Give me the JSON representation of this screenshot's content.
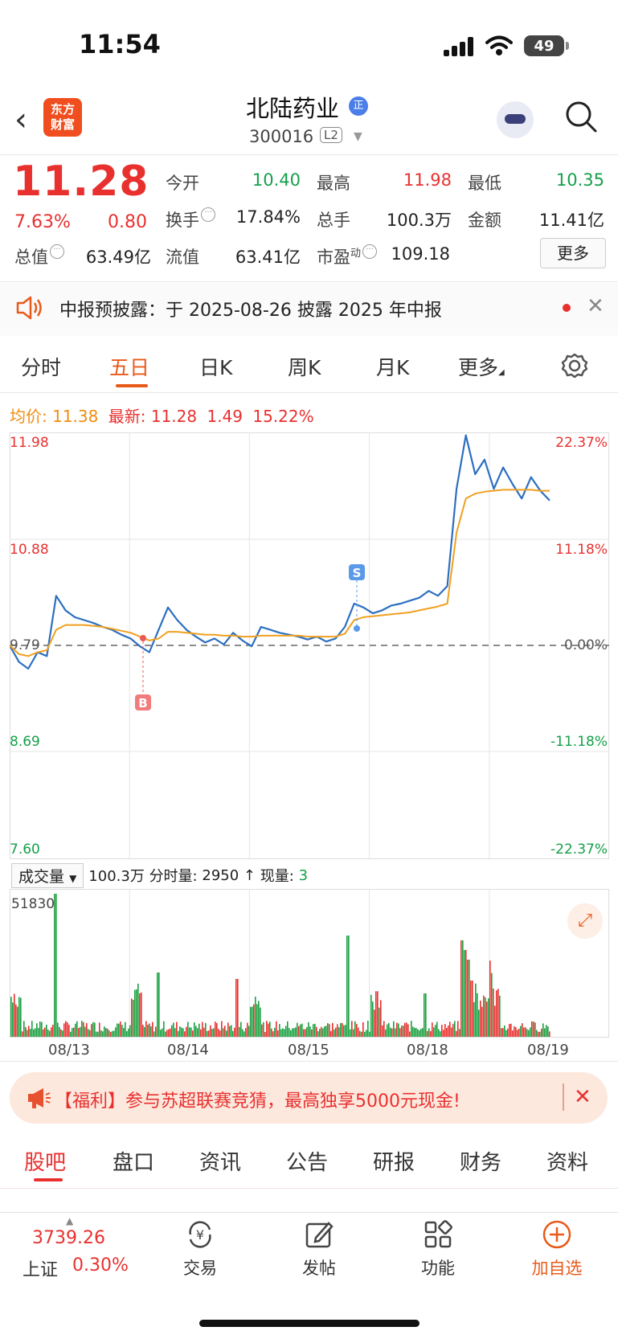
{
  "status_bar": {
    "time": "11:54",
    "battery": "49"
  },
  "header": {
    "logo_line1": "东方",
    "logo_line2": "财富",
    "stock_name": "北陆药业",
    "badge": "正",
    "stock_code": "300016",
    "level": "L2"
  },
  "quote": {
    "price": "11.28",
    "change_pct": "7.63%",
    "change": "0.80",
    "fields": {
      "open_label": "今开",
      "open": "10.40",
      "high_label": "最高",
      "high": "11.98",
      "low_label": "最低",
      "low": "10.35",
      "turnover_label": "换手",
      "turnover": "17.84%",
      "volume_label": "总手",
      "volume": "100.3万",
      "amount_label": "金额",
      "amount": "11.41亿",
      "mktcap_label": "总值",
      "mktcap": "63.49亿",
      "float_label": "流值",
      "float": "63.41亿",
      "pe_label": "市盈",
      "pe_sup": "动",
      "pe": "109.18"
    },
    "more_label": "更多"
  },
  "notice": {
    "text": "中报预披露：于 2025-08-26 披露 2025 年中报"
  },
  "chart_tabs": {
    "items": [
      "分时",
      "五日",
      "日K",
      "周K",
      "月K",
      "更多"
    ],
    "active": "五日"
  },
  "legend": {
    "avg_label": "均价:",
    "avg": "11.38",
    "latest_label": "最新:",
    "latest": "11.28",
    "latest_change": "1.49",
    "latest_pct": "15.22%"
  },
  "chart_data": {
    "type": "line",
    "x_labels": [
      "08/13",
      "08/14",
      "08/15",
      "08/18",
      "08/19"
    ],
    "y_ticks_left": [
      "11.98",
      "10.88",
      "9.79",
      "8.69",
      "7.60"
    ],
    "y_ticks_right": [
      "22.37%",
      "11.18%",
      "0.00%",
      "-11.18%",
      "-22.37%"
    ],
    "ylim": [
      7.6,
      11.98
    ],
    "base_price": 9.79,
    "series": [
      {
        "values": [
          9.79,
          9.62,
          9.55,
          9.72,
          9.68,
          10.3,
          10.15,
          10.08,
          10.05,
          10.02,
          9.98,
          9.95,
          9.9,
          9.86,
          9.78,
          9.72,
          9.95,
          10.18,
          10.05,
          9.95,
          9.88,
          9.82,
          9.86,
          9.8,
          9.92,
          9.84,
          9.78,
          9.98,
          9.95,
          9.92,
          9.9,
          9.88,
          9.85,
          9.88,
          9.83,
          9.86,
          9.98,
          10.22,
          10.18,
          10.12,
          10.15,
          10.2,
          10.22,
          10.25,
          10.28,
          10.35,
          10.3,
          10.4,
          11.4,
          11.95,
          11.55,
          11.7,
          11.4,
          11.62,
          11.45,
          11.3,
          11.52,
          11.38,
          11.28
        ]
      },
      {
        "values": [
          9.79,
          9.7,
          9.68,
          9.72,
          9.74,
          9.95,
          10.0,
          10.0,
          10.0,
          9.99,
          9.98,
          9.96,
          9.94,
          9.92,
          9.88,
          9.84,
          9.86,
          9.93,
          9.93,
          9.92,
          9.91,
          9.9,
          9.9,
          9.89,
          9.89,
          9.88,
          9.88,
          9.89,
          9.89,
          9.89,
          9.89,
          9.89,
          9.88,
          9.88,
          9.88,
          9.88,
          9.91,
          10.05,
          10.08,
          10.09,
          10.1,
          10.11,
          10.12,
          10.13,
          10.15,
          10.17,
          10.19,
          10.22,
          10.95,
          11.3,
          11.35,
          11.37,
          11.38,
          11.39,
          11.39,
          11.39,
          11.39,
          11.38,
          11.38
        ]
      }
    ],
    "markers": [
      {
        "label": "B",
        "color": "#e85a5a"
      },
      {
        "label": "S",
        "color": "#4b8ee8"
      }
    ],
    "volume": {
      "label": "成交量",
      "total": "100.3万",
      "minute_label": "分时量:",
      "minute": "2950",
      "current_label": "现量:",
      "current": "3",
      "max_tick": "51830"
    }
  },
  "promo": {
    "text": "【福利】参与苏超联赛竞猜，最高独享5000元现金!"
  },
  "bottom_tabs": {
    "items": [
      "股吧",
      "盘口",
      "资讯",
      "公告",
      "研报",
      "财务",
      "资料"
    ],
    "active": "股吧"
  },
  "bottom_nav": {
    "index_value": "3739.26",
    "index_name": "上证",
    "index_pct": "0.30%",
    "items": [
      "交易",
      "发帖",
      "功能",
      "加自选"
    ]
  },
  "colors": {
    "red": "#e8312f",
    "green": "#14a04a",
    "accent": "#e85a1a",
    "line": "#2c6fc0",
    "avg": "#f0a020"
  }
}
